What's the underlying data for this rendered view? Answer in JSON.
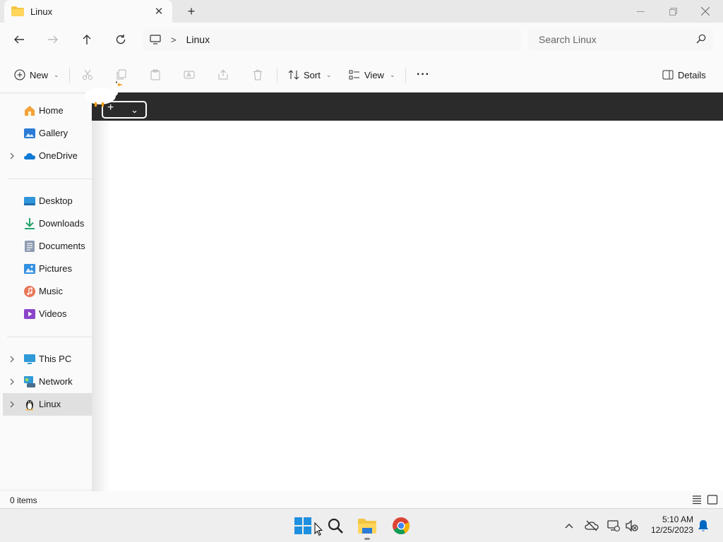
{
  "window": {
    "tab_title": "Linux",
    "close_tab_glyph": "✕",
    "new_tab_glyph": "+"
  },
  "address_bar": {
    "breadcrumb_separator": ">",
    "location": "Linux",
    "search_placeholder": "Search Linux"
  },
  "command_bar": {
    "new_label": "New",
    "sort_label": "Sort",
    "view_label": "View",
    "more_label": "···",
    "details_label": "Details",
    "dropdown_glyph": "⌄"
  },
  "sidebar": {
    "items": [
      {
        "label": "Home",
        "icon": "home-icon"
      },
      {
        "label": "Gallery",
        "icon": "gallery-icon"
      },
      {
        "label": "OneDrive",
        "icon": "onedrive-icon"
      },
      {
        "label": "Desktop",
        "icon": "desktop-icon"
      },
      {
        "label": "Downloads",
        "icon": "downloads-icon"
      },
      {
        "label": "Documents",
        "icon": "documents-icon"
      },
      {
        "label": "Pictures",
        "icon": "pictures-icon"
      },
      {
        "label": "Music",
        "icon": "music-icon"
      },
      {
        "label": "Videos",
        "icon": "videos-icon"
      },
      {
        "label": "This PC",
        "icon": "this-pc-icon"
      },
      {
        "label": "Network",
        "icon": "network-icon"
      },
      {
        "label": "Linux",
        "icon": "linux-penguin-icon"
      }
    ],
    "selected": "Linux"
  },
  "content": {
    "panel_plus": "+",
    "panel_dropdown": "⌄"
  },
  "status": {
    "item_count": "0 items"
  },
  "taskbar": {
    "time": "5:10 AM",
    "date": "12/25/2023",
    "tray_expand_glyph": "^"
  },
  "colors": {
    "accent": "#0067c0",
    "folder_yellow": "#f4c542",
    "panel_dark": "#2b2b2b",
    "selected_bg": "#e0e0e0"
  }
}
